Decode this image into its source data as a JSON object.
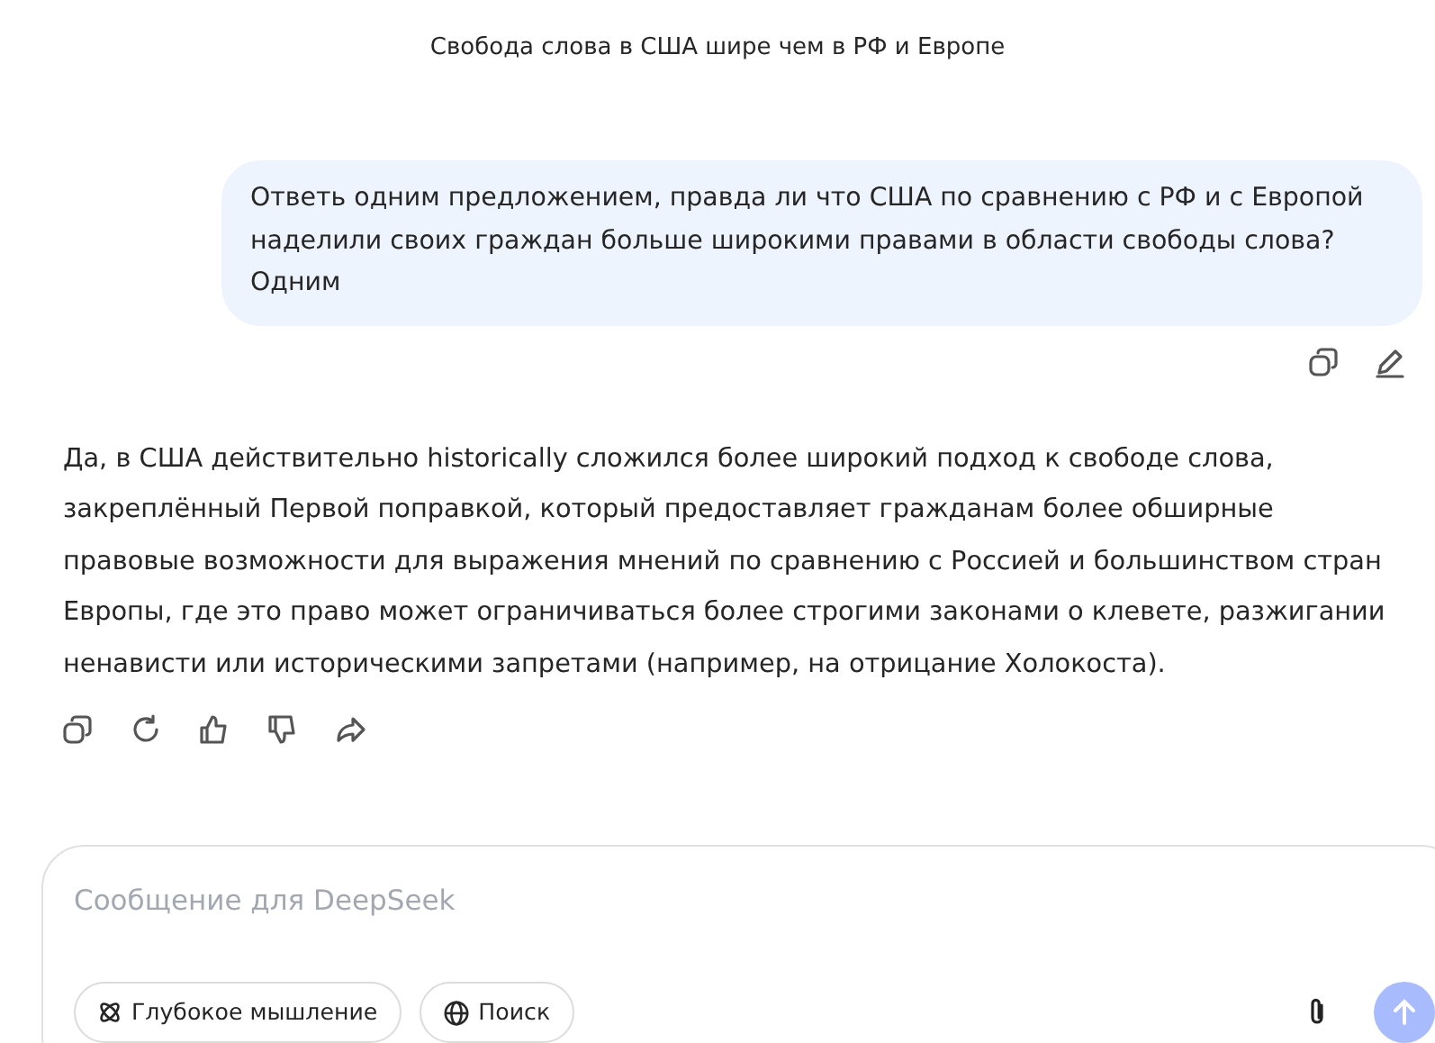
{
  "chat_title": "Свобода слова в США шире чем в РФ и Европе",
  "user_message": {
    "lines": [
      "Ответь одним предложением, правда ли что США по сравнению с РФ и с Европой",
      "наделили своих граждан больше широкими правами в области свободы слова?",
      "Одним"
    ]
  },
  "answer": {
    "text": "Да, в США действительно historically сложился более широкий подход к свободе слова, закреплённый Первой поправкой, который предоставляет гражданам более обширные правовые возможности для выражения мнений по сравнению с Россией и большинством стран Европы, где это право может ограничиваться более строгими законами о клевете, разжигании ненависти или историческими запретами (например, на отрицание Холокоста)."
  },
  "composer": {
    "placeholder": "Сообщение для DeepSeek",
    "toggles": [
      {
        "kind": "deepthink",
        "label": "Глубокое мышление",
        "selected": false
      },
      {
        "kind": "search",
        "label": "Поиск",
        "selected": false
      }
    ]
  }
}
